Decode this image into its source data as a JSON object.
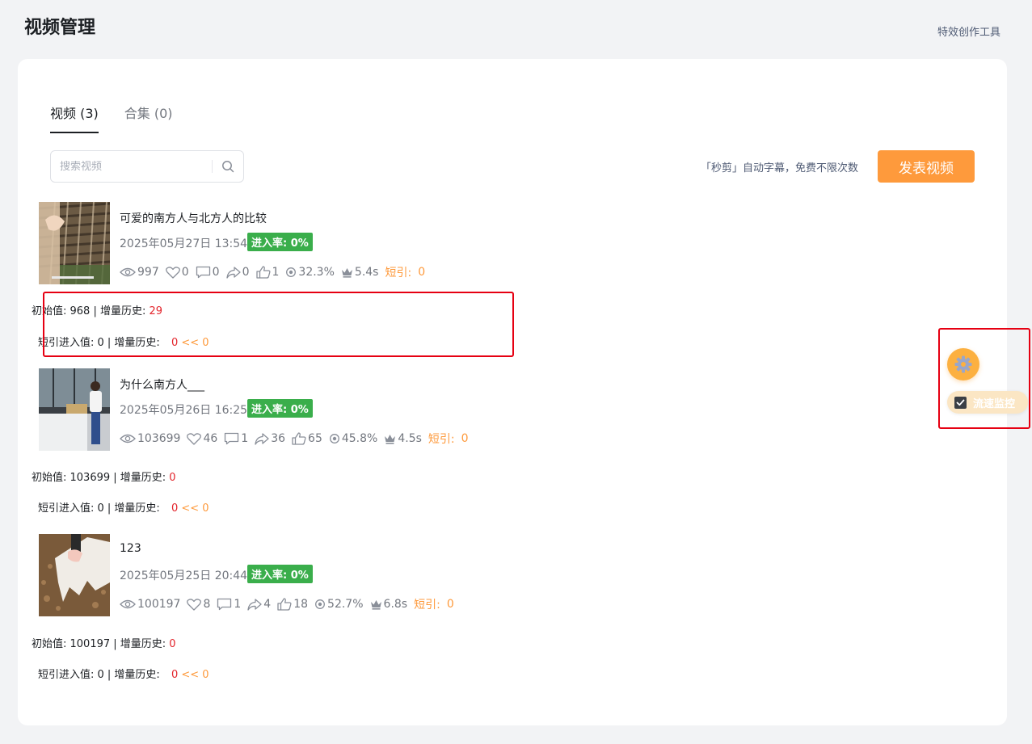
{
  "header": {
    "title": "视频管理",
    "tool_link": "特效创作工具"
  },
  "tabs": [
    {
      "label": "视频 (3)"
    },
    {
      "label": "合集 (0)"
    }
  ],
  "search": {
    "placeholder": "搜索视频"
  },
  "promo_text": "「秒剪」自动字幕，免费不限次数",
  "publish_label": "发表视频",
  "videos": [
    {
      "title": "可爱的南方人与北方人的比较",
      "date": "2025年05月27日 13:54",
      "badge": "进入率: 0%",
      "views": "997",
      "likes": "0",
      "comments": "0",
      "shares": "0",
      "thumbs": "1",
      "rate": "32.3%",
      "duration": "5.4s",
      "short_label": "短引:",
      "short_value": "0",
      "init_label": "初始值: 968 | 增量历史: ",
      "init_delta": "29",
      "short_entry_label": "短引进入值: 0 | 增量历史:",
      "short_entry_value": "0",
      "short_entry_hist": "<< 0"
    },
    {
      "title": "为什么南方人___",
      "date": "2025年05月26日 16:25",
      "badge": "进入率: 0%",
      "views": "103699",
      "likes": "46",
      "comments": "1",
      "shares": "36",
      "thumbs": "65",
      "rate": "45.8%",
      "duration": "4.5s",
      "short_label": "短引:",
      "short_value": "0",
      "init_label": "初始值: 103699 | 增量历史: ",
      "init_delta": "0",
      "short_entry_label": "短引进入值: 0 | 增量历史:",
      "short_entry_value": "0",
      "short_entry_hist": "<< 0"
    },
    {
      "title": "123",
      "date": "2025年05月25日 20:44",
      "badge": "进入率: 0%",
      "views": "100197",
      "likes": "8",
      "comments": "1",
      "shares": "4",
      "thumbs": "18",
      "rate": "52.7%",
      "duration": "6.8s",
      "short_label": "短引:",
      "short_value": "0",
      "init_label": "初始值: 100197 | 增量历史: ",
      "init_delta": "0",
      "short_entry_label": "短引进入值: 0 | 增量历史:",
      "short_entry_value": "0",
      "short_entry_hist": "<< 0"
    }
  ],
  "side_widget": {
    "monitor_label": "流速监控",
    "monitor_checked": true
  },
  "colors": {
    "accent": "#fe9a3c",
    "badge_green": "#3aae4b",
    "highlight_red": "#e60012",
    "delta_red": "#e3242b"
  }
}
